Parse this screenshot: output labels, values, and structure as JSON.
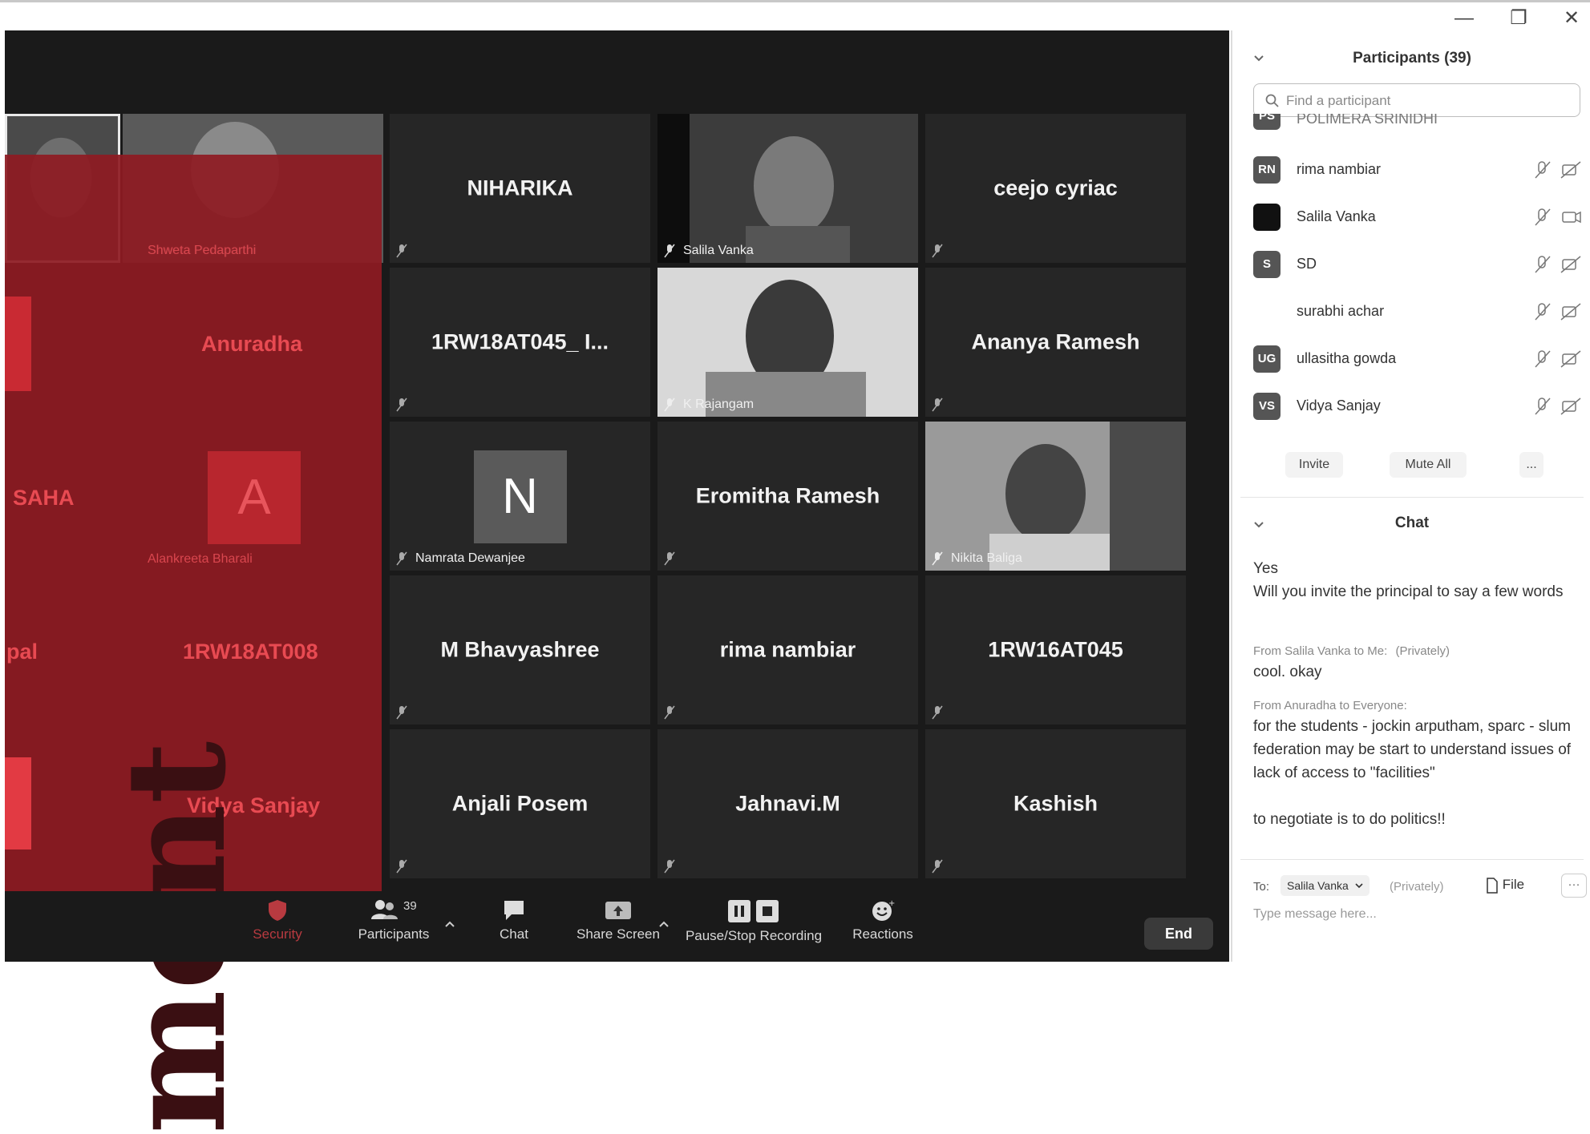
{
  "window": {
    "minimize": "—",
    "restore": "❐",
    "close": "✕"
  },
  "tiles": [
    {
      "name": "",
      "caption": "Shweta Pedaparthi"
    },
    {
      "name": "NIHARIKA",
      "caption": ""
    },
    {
      "name": "",
      "caption": "Salila Vanka"
    },
    {
      "name": "ceejo cyriac",
      "caption": ""
    },
    {
      "name": "Anuradha",
      "caption": ""
    },
    {
      "name": "1RW18AT045_ I...",
      "caption": ""
    },
    {
      "name": "",
      "caption": "K Rajangam"
    },
    {
      "name": "Ananya Ramesh",
      "caption": ""
    },
    {
      "name": "SAHA",
      "caption": ""
    },
    {
      "name": "",
      "caption": "Alankreeta Bharali",
      "avatar": "A"
    },
    {
      "name": "",
      "caption": "Namrata Dewanjee",
      "avatar": "N"
    },
    {
      "name": "Eromitha Ramesh",
      "caption": ""
    },
    {
      "name": "",
      "caption": "Nikita Baliga"
    },
    {
      "name": "pal",
      "caption": ""
    },
    {
      "name": "1RW18AT008",
      "caption": ""
    },
    {
      "name": "M Bhavyashree",
      "caption": ""
    },
    {
      "name": "rima nambiar",
      "caption": ""
    },
    {
      "name": "1RW16AT045",
      "caption": ""
    },
    {
      "name": "Vidya Sanjay",
      "caption": ""
    },
    {
      "name": "Anjali Posem",
      "caption": ""
    },
    {
      "name": "Jahnavi.M",
      "caption": ""
    },
    {
      "name": "Kashish",
      "caption": ""
    }
  ],
  "overlay_text": "ment",
  "toolbar": {
    "security": "Security",
    "participants": "Participants",
    "participants_count": "39",
    "chat": "Chat",
    "share": "Share Screen",
    "record": "Pause/Stop Recording",
    "reactions": "Reactions",
    "end": "End"
  },
  "participants_panel": {
    "title": "Participants (39)",
    "search_placeholder": "Find a participant",
    "items": [
      {
        "initials": "PS",
        "name": "POLIMERA SRINIDHI"
      },
      {
        "initials": "RN",
        "name": "rima nambiar"
      },
      {
        "initials": "",
        "name": "Salila Vanka"
      },
      {
        "initials": "S",
        "name": "SD"
      },
      {
        "initials": "",
        "name": "surabhi achar"
      },
      {
        "initials": "UG",
        "name": "ullasitha gowda"
      },
      {
        "initials": "VS",
        "name": "Vidya Sanjay"
      }
    ],
    "invite": "Invite",
    "mute_all": "Mute All",
    "more": "..."
  },
  "chat_panel": {
    "title": "Chat",
    "messages": [
      {
        "from": "",
        "text": "Yes"
      },
      {
        "from": "",
        "text": "Will you invite the principal to say a few words"
      },
      {
        "from": "From Salila Vanka to Me:",
        "private": "(Privately)",
        "text": "cool. okay"
      },
      {
        "from": "From Anuradha to Everyone:",
        "private": "",
        "text": "for the students - jockin arputham, sparc - slum federation may be start to understand issues of lack of access to \"facilities\""
      },
      {
        "from": "",
        "text": "to negotiate is to do politics!!"
      }
    ],
    "to_label": "To:",
    "to_value": "Salila Vanka",
    "to_private": "(Privately)",
    "file": "File",
    "more": "···",
    "placeholder": "Type message here..."
  },
  "colors": {
    "overlay": "#8e1b22",
    "dark_bg": "#1a1a1a",
    "tile_bg": "#262626"
  }
}
